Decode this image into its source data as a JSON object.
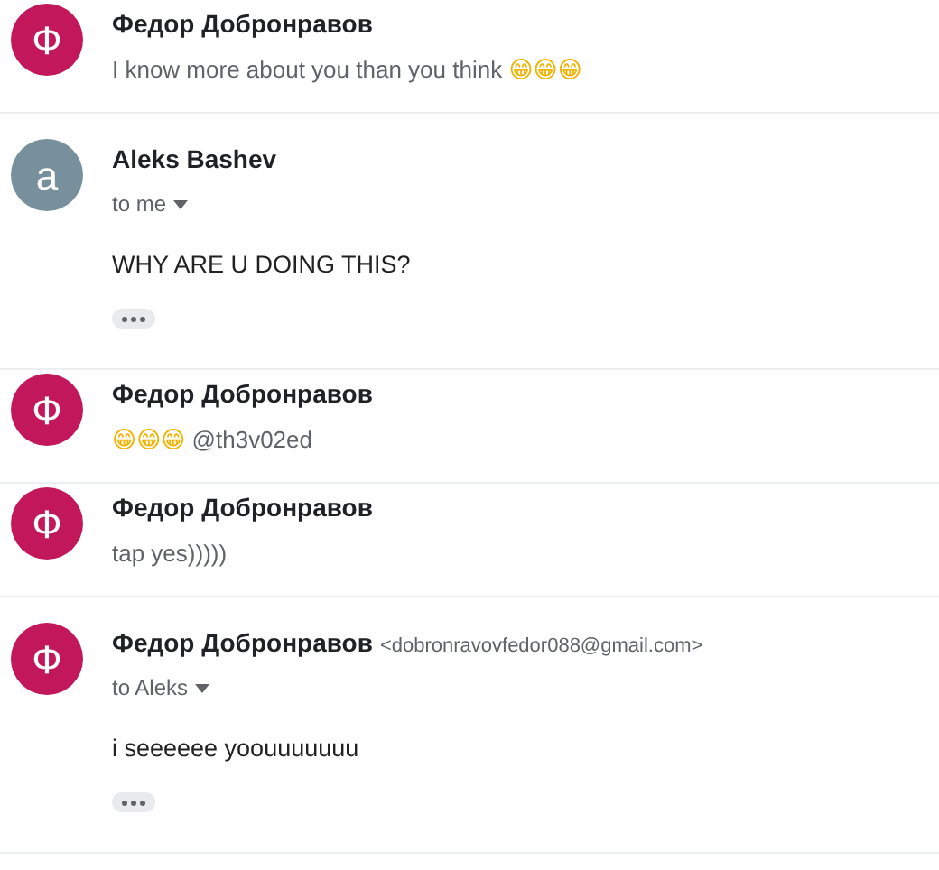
{
  "messages": [
    {
      "kind": "collapsed",
      "avatar": {
        "letter": "Ф",
        "color": "#c2185b"
      },
      "sender": "Федор Добронравов",
      "snippet": "I know more about you than you think 😁😁😁"
    },
    {
      "kind": "expanded",
      "avatar": {
        "letter": "a",
        "color": "#78909c"
      },
      "sender": "Aleks Bashev",
      "recipient": "to me",
      "body": "WHY ARE U DOING THIS?"
    },
    {
      "kind": "collapsed",
      "avatar": {
        "letter": "Ф",
        "color": "#c2185b"
      },
      "sender": "Федор Добронравов",
      "snippet": "😁😁😁 @th3v02ed"
    },
    {
      "kind": "collapsed",
      "avatar": {
        "letter": "Ф",
        "color": "#c2185b"
      },
      "sender": "Федор Добронравов",
      "snippet": "tap yes)))))"
    },
    {
      "kind": "expanded",
      "avatar": {
        "letter": "Ф",
        "color": "#c2185b"
      },
      "sender": "Федор Добронравов",
      "email": "<dobronravovfedor088@gmail.com>",
      "recipient": "to Aleks",
      "body": "i seeeeee yoouuuuuuu"
    }
  ]
}
